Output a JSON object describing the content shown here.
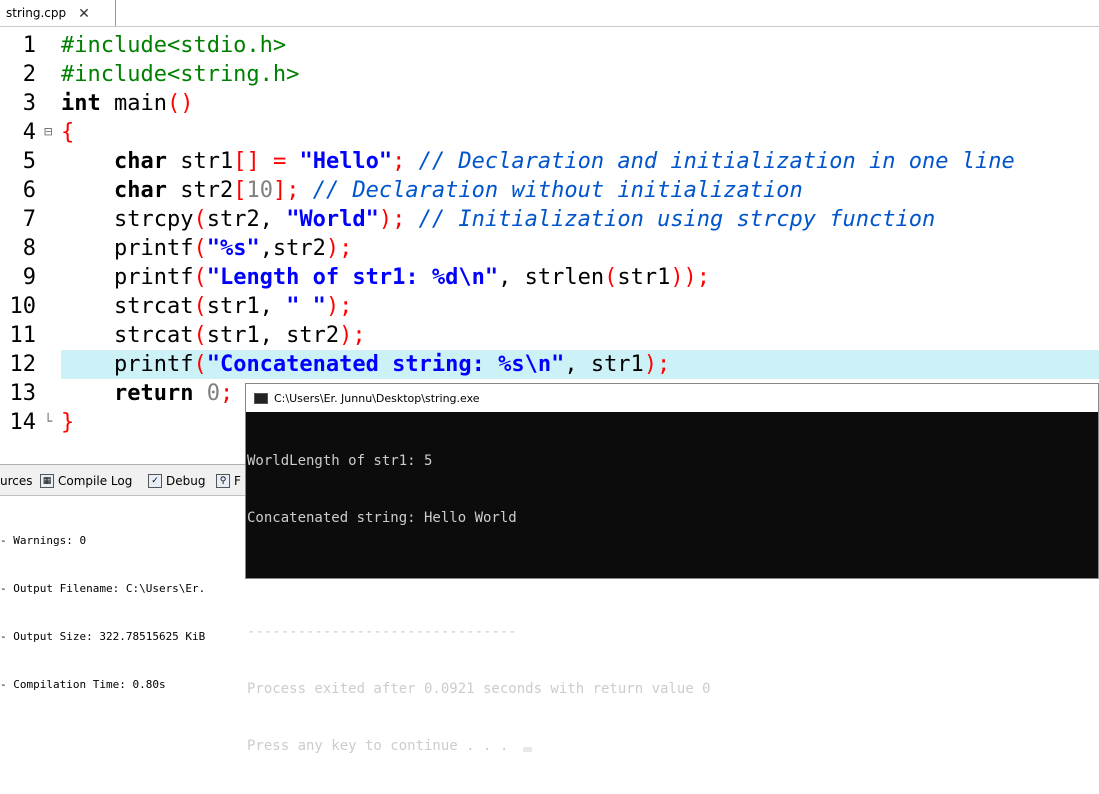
{
  "tab": {
    "label": "string.cpp",
    "close": "✕"
  },
  "code_lines": [
    {
      "n": "1",
      "fold": "",
      "html": [
        [
          "pp",
          "#include<stdio.h>"
        ]
      ]
    },
    {
      "n": "2",
      "fold": "",
      "html": [
        [
          "pp",
          "#include<string.h>"
        ]
      ]
    },
    {
      "n": "3",
      "fold": "",
      "html": [
        [
          "kw",
          "int"
        ],
        [
          "id",
          " main"
        ],
        [
          "sym",
          "()"
        ]
      ]
    },
    {
      "n": "4",
      "fold": "⊟",
      "html": [
        [
          "sym",
          "{"
        ]
      ]
    },
    {
      "n": "5",
      "fold": "",
      "html": [
        [
          "id",
          "    "
        ],
        [
          "kw",
          "char"
        ],
        [
          "id",
          " str1"
        ],
        [
          "sym",
          "[]"
        ],
        [
          "id",
          " "
        ],
        [
          "sym",
          "="
        ],
        [
          "id",
          " "
        ],
        [
          "str",
          "\"Hello\""
        ],
        [
          "sym",
          ";"
        ],
        [
          "id",
          " "
        ],
        [
          "cm",
          "// Declaration and initialization in one line"
        ]
      ]
    },
    {
      "n": "6",
      "fold": "",
      "html": [
        [
          "id",
          "    "
        ],
        [
          "kw",
          "char"
        ],
        [
          "id",
          " str2"
        ],
        [
          "sym",
          "["
        ],
        [
          "num",
          "10"
        ],
        [
          "sym",
          "];"
        ],
        [
          "id",
          " "
        ],
        [
          "cm",
          "// Declaration without initialization"
        ]
      ]
    },
    {
      "n": "7",
      "fold": "",
      "html": [
        [
          "id",
          "    strcpy"
        ],
        [
          "sym",
          "("
        ],
        [
          "id",
          "str2, "
        ],
        [
          "str",
          "\"World\""
        ],
        [
          "sym",
          ");"
        ],
        [
          "id",
          " "
        ],
        [
          "cm",
          "// Initialization using strcpy function"
        ]
      ]
    },
    {
      "n": "8",
      "fold": "",
      "html": [
        [
          "id",
          "    printf"
        ],
        [
          "sym",
          "("
        ],
        [
          "str",
          "\"%s\""
        ],
        [
          "id",
          ",str2"
        ],
        [
          "sym",
          ");"
        ]
      ]
    },
    {
      "n": "9",
      "fold": "",
      "html": [
        [
          "id",
          "    printf"
        ],
        [
          "sym",
          "("
        ],
        [
          "str",
          "\"Length of str1: %d\\n\""
        ],
        [
          "id",
          ", strlen"
        ],
        [
          "sym",
          "("
        ],
        [
          "id",
          "str1"
        ],
        [
          "sym",
          "));"
        ]
      ]
    },
    {
      "n": "10",
      "fold": "",
      "html": [
        [
          "id",
          "    strcat"
        ],
        [
          "sym",
          "("
        ],
        [
          "id",
          "str1, "
        ],
        [
          "str",
          "\" \""
        ],
        [
          "sym",
          ");"
        ]
      ]
    },
    {
      "n": "11",
      "fold": "",
      "html": [
        [
          "id",
          "    strcat"
        ],
        [
          "sym",
          "("
        ],
        [
          "id",
          "str1, str2"
        ],
        [
          "sym",
          ");"
        ]
      ]
    },
    {
      "n": "12",
      "fold": "",
      "current": true,
      "html": [
        [
          "id",
          "    printf"
        ],
        [
          "sym",
          "("
        ],
        [
          "str",
          "\"Concatenated string: %s\\n\""
        ],
        [
          "id",
          ", str1"
        ],
        [
          "sym",
          ");"
        ]
      ]
    },
    {
      "n": "13",
      "fold": "",
      "html": [
        [
          "id",
          "    "
        ],
        [
          "kw",
          "return"
        ],
        [
          "id",
          " "
        ],
        [
          "num",
          "0"
        ],
        [
          "sym",
          ";"
        ]
      ]
    },
    {
      "n": "14",
      "fold": "└",
      "html": [
        [
          "sym",
          "}"
        ]
      ]
    }
  ],
  "bottom": {
    "tabs": [
      "urces",
      "Compile Log",
      "Debug",
      "F"
    ],
    "log": [
      "- Warnings: 0",
      "- Output Filename: C:\\Users\\Er.",
      "- Output Size: 322.78515625 KiB",
      "- Compilation Time: 0.80s"
    ]
  },
  "console": {
    "title": "C:\\Users\\Er. Junnu\\Desktop\\string.exe",
    "lines": [
      "WorldLength of str1: 5",
      "Concatenated string: Hello World",
      "",
      "--------------------------------",
      "Process exited after 0.0921 seconds with return value 0",
      "Press any key to continue . . . "
    ]
  }
}
